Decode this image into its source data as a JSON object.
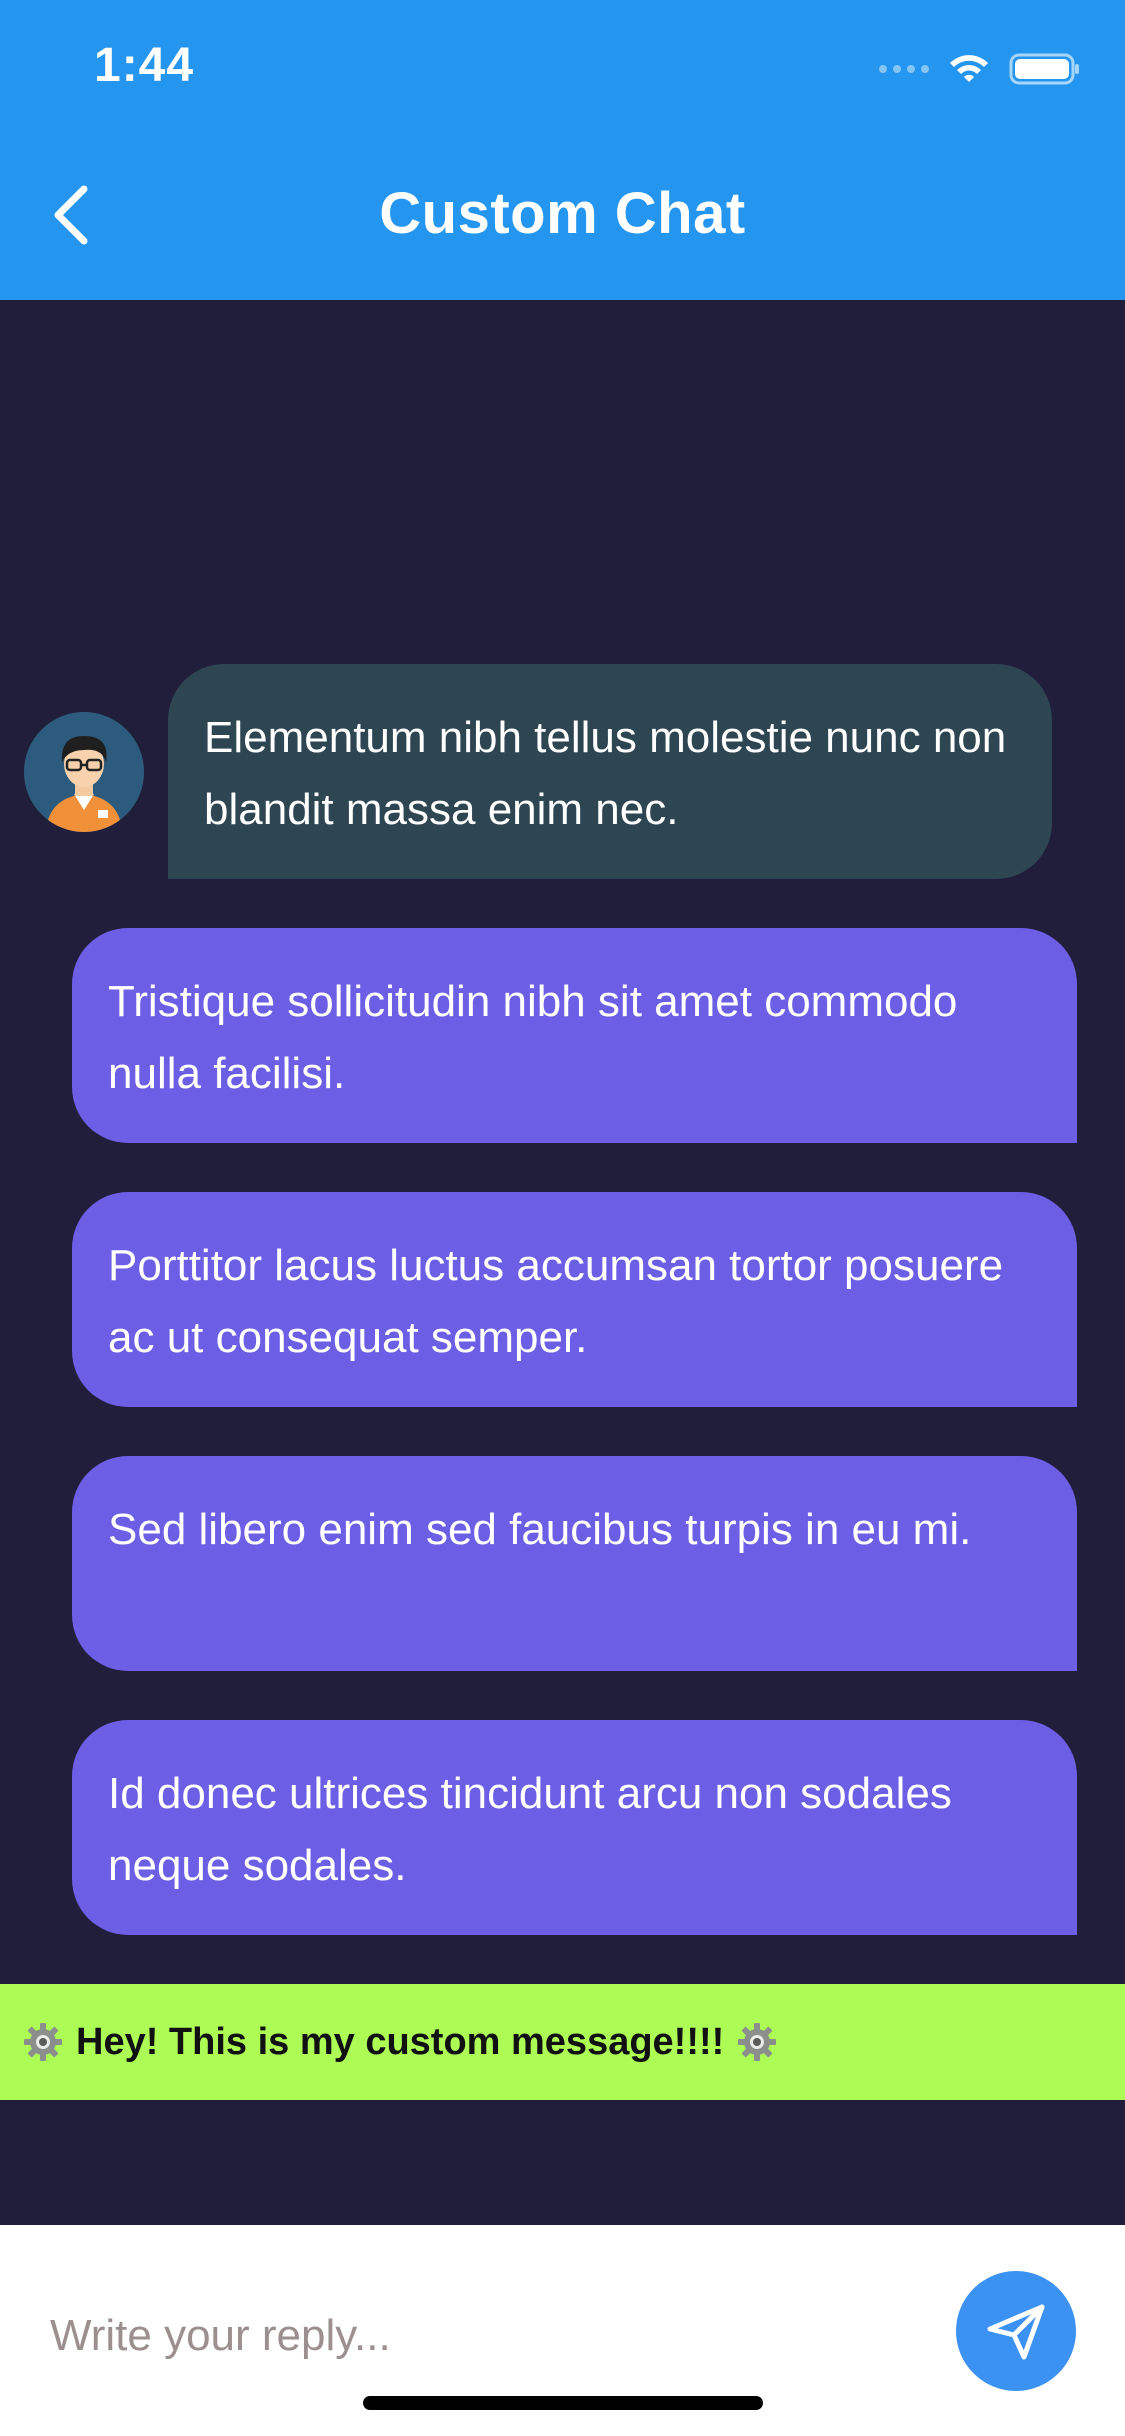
{
  "status_bar": {
    "time": "1:44",
    "icons": [
      "signal-icon",
      "wifi-icon",
      "battery-icon"
    ]
  },
  "header": {
    "title": "Custom Chat",
    "back_icon": "chevron-left-icon",
    "background": "#2596f0"
  },
  "messages": [
    {
      "type": "received",
      "text": "Elementum nibh tellus molestie nunc non blandit massa enim nec."
    },
    {
      "type": "sent",
      "text": "Tristique sollicitudin nibh sit amet commodo nulla facilisi."
    },
    {
      "type": "sent",
      "text": "Porttitor lacus luctus accumsan tortor posuere ac ut consequat semper."
    },
    {
      "type": "sent",
      "text": "Sed libero enim sed faucibus turpis in eu mi."
    },
    {
      "type": "sent",
      "text": "Id donec ultrices tincidunt arcu non sodales neque sodales."
    }
  ],
  "custom_message": {
    "text": "Hey! This is my custom message!!!!",
    "icon": "gear-icon"
  },
  "composer": {
    "placeholder": "Write your reply...",
    "send_icon": "send-icon"
  },
  "colors": {
    "background": "#201e3b",
    "received_bubble": "#2e4552",
    "sent_bubble": "#6c5fe6",
    "custom_banner": "#adfc56",
    "send_button": "#3b92f3"
  }
}
